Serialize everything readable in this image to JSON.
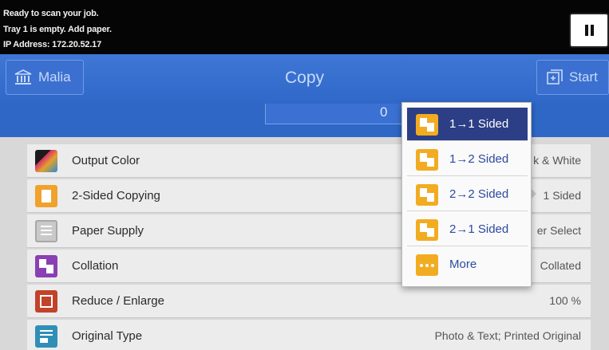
{
  "status": {
    "line1": "Ready to scan your job.",
    "line2": "Tray 1 is empty.  Add paper.",
    "line3": "IP Address: 172.20.52.17"
  },
  "header": {
    "back_label": "Malia",
    "title": "Copy",
    "start_label": "Start"
  },
  "quantity": "0",
  "settings": [
    {
      "label": "Output Color",
      "value": "k & White"
    },
    {
      "label": "2-Sided Copying",
      "value": "1 Sided"
    },
    {
      "label": "Paper Supply",
      "value": "er Select"
    },
    {
      "label": "Collation",
      "value": "Collated"
    },
    {
      "label": "Reduce / Enlarge",
      "value": "100 %"
    },
    {
      "label": "Original Type",
      "value": "Photo & Text; Printed Original"
    }
  ],
  "popup": {
    "options": [
      {
        "label": "1→1 Sided",
        "selected": true
      },
      {
        "label": "1→2 Sided",
        "selected": false
      },
      {
        "label": "2→2 Sided",
        "selected": false
      },
      {
        "label": "2→1 Sided",
        "selected": false
      },
      {
        "label": "More",
        "selected": false
      }
    ]
  },
  "colors": {
    "header_blue": "#3068c9",
    "selected_navy": "#2c3e86",
    "icon_orange": "#f2ac21"
  }
}
